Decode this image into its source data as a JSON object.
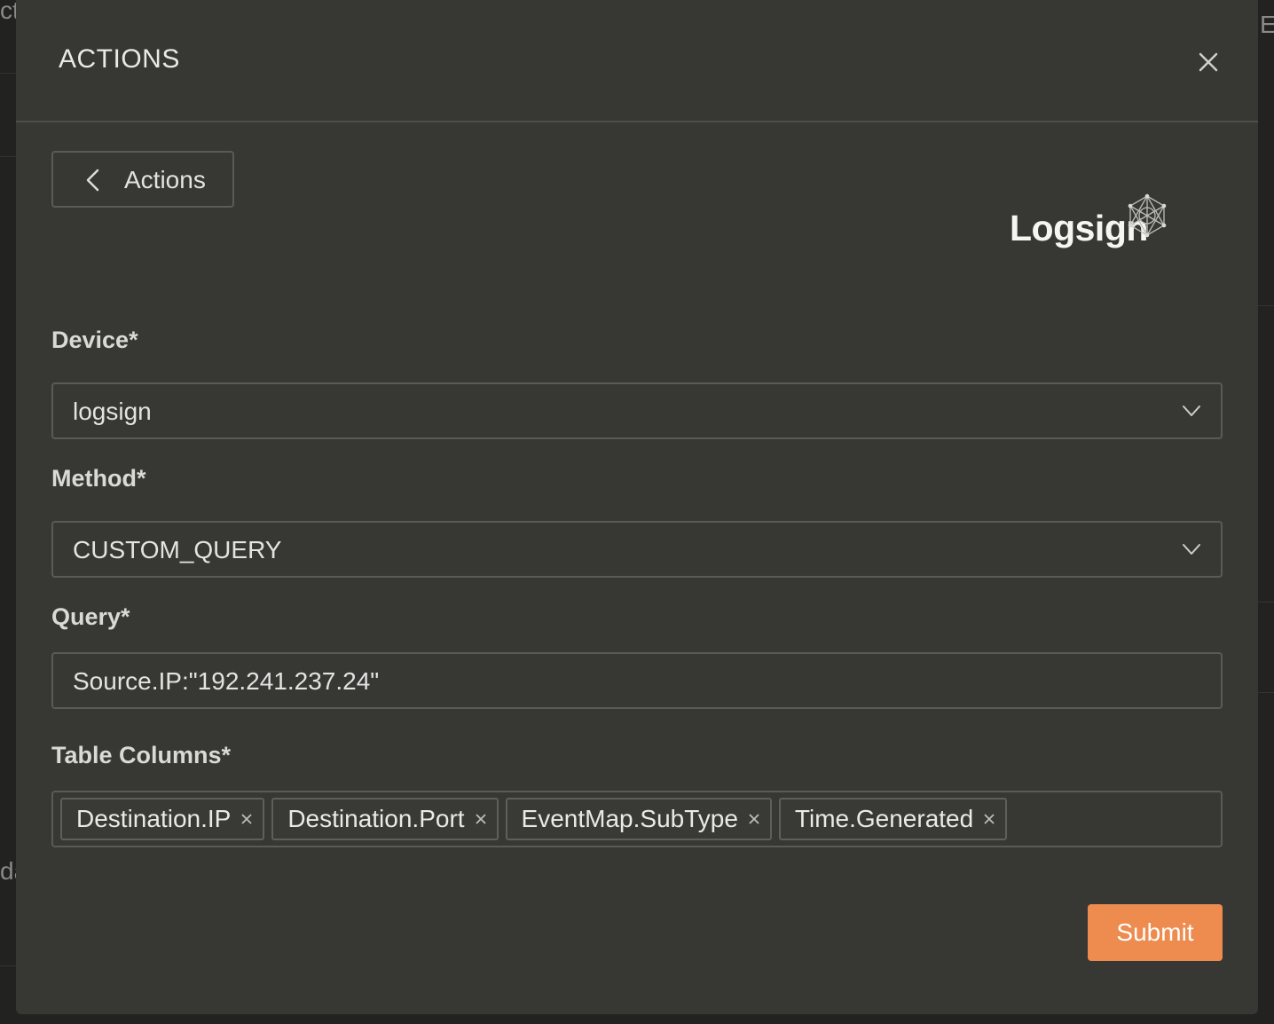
{
  "modal": {
    "title": "ACTIONS",
    "back_label": "Actions",
    "logo_text": "Logsign"
  },
  "form": {
    "device": {
      "label": "Device*",
      "value": "logsign"
    },
    "method": {
      "label": "Method*",
      "value": "CUSTOM_QUERY"
    },
    "query": {
      "label": "Query*",
      "value": "Source.IP:\"192.241.237.24\""
    },
    "table_columns": {
      "label": "Table Columns*",
      "tags": [
        "Destination.IP",
        "Destination.Port",
        "EventMap.SubType",
        "Time.Generated"
      ]
    },
    "submit_label": "Submit"
  },
  "background": {
    "fragments": [
      "ct",
      "E",
      "da"
    ]
  },
  "colors": {
    "modal_bg": "#373734",
    "accent": "#ee8b4f",
    "border": "#5a5a57"
  }
}
